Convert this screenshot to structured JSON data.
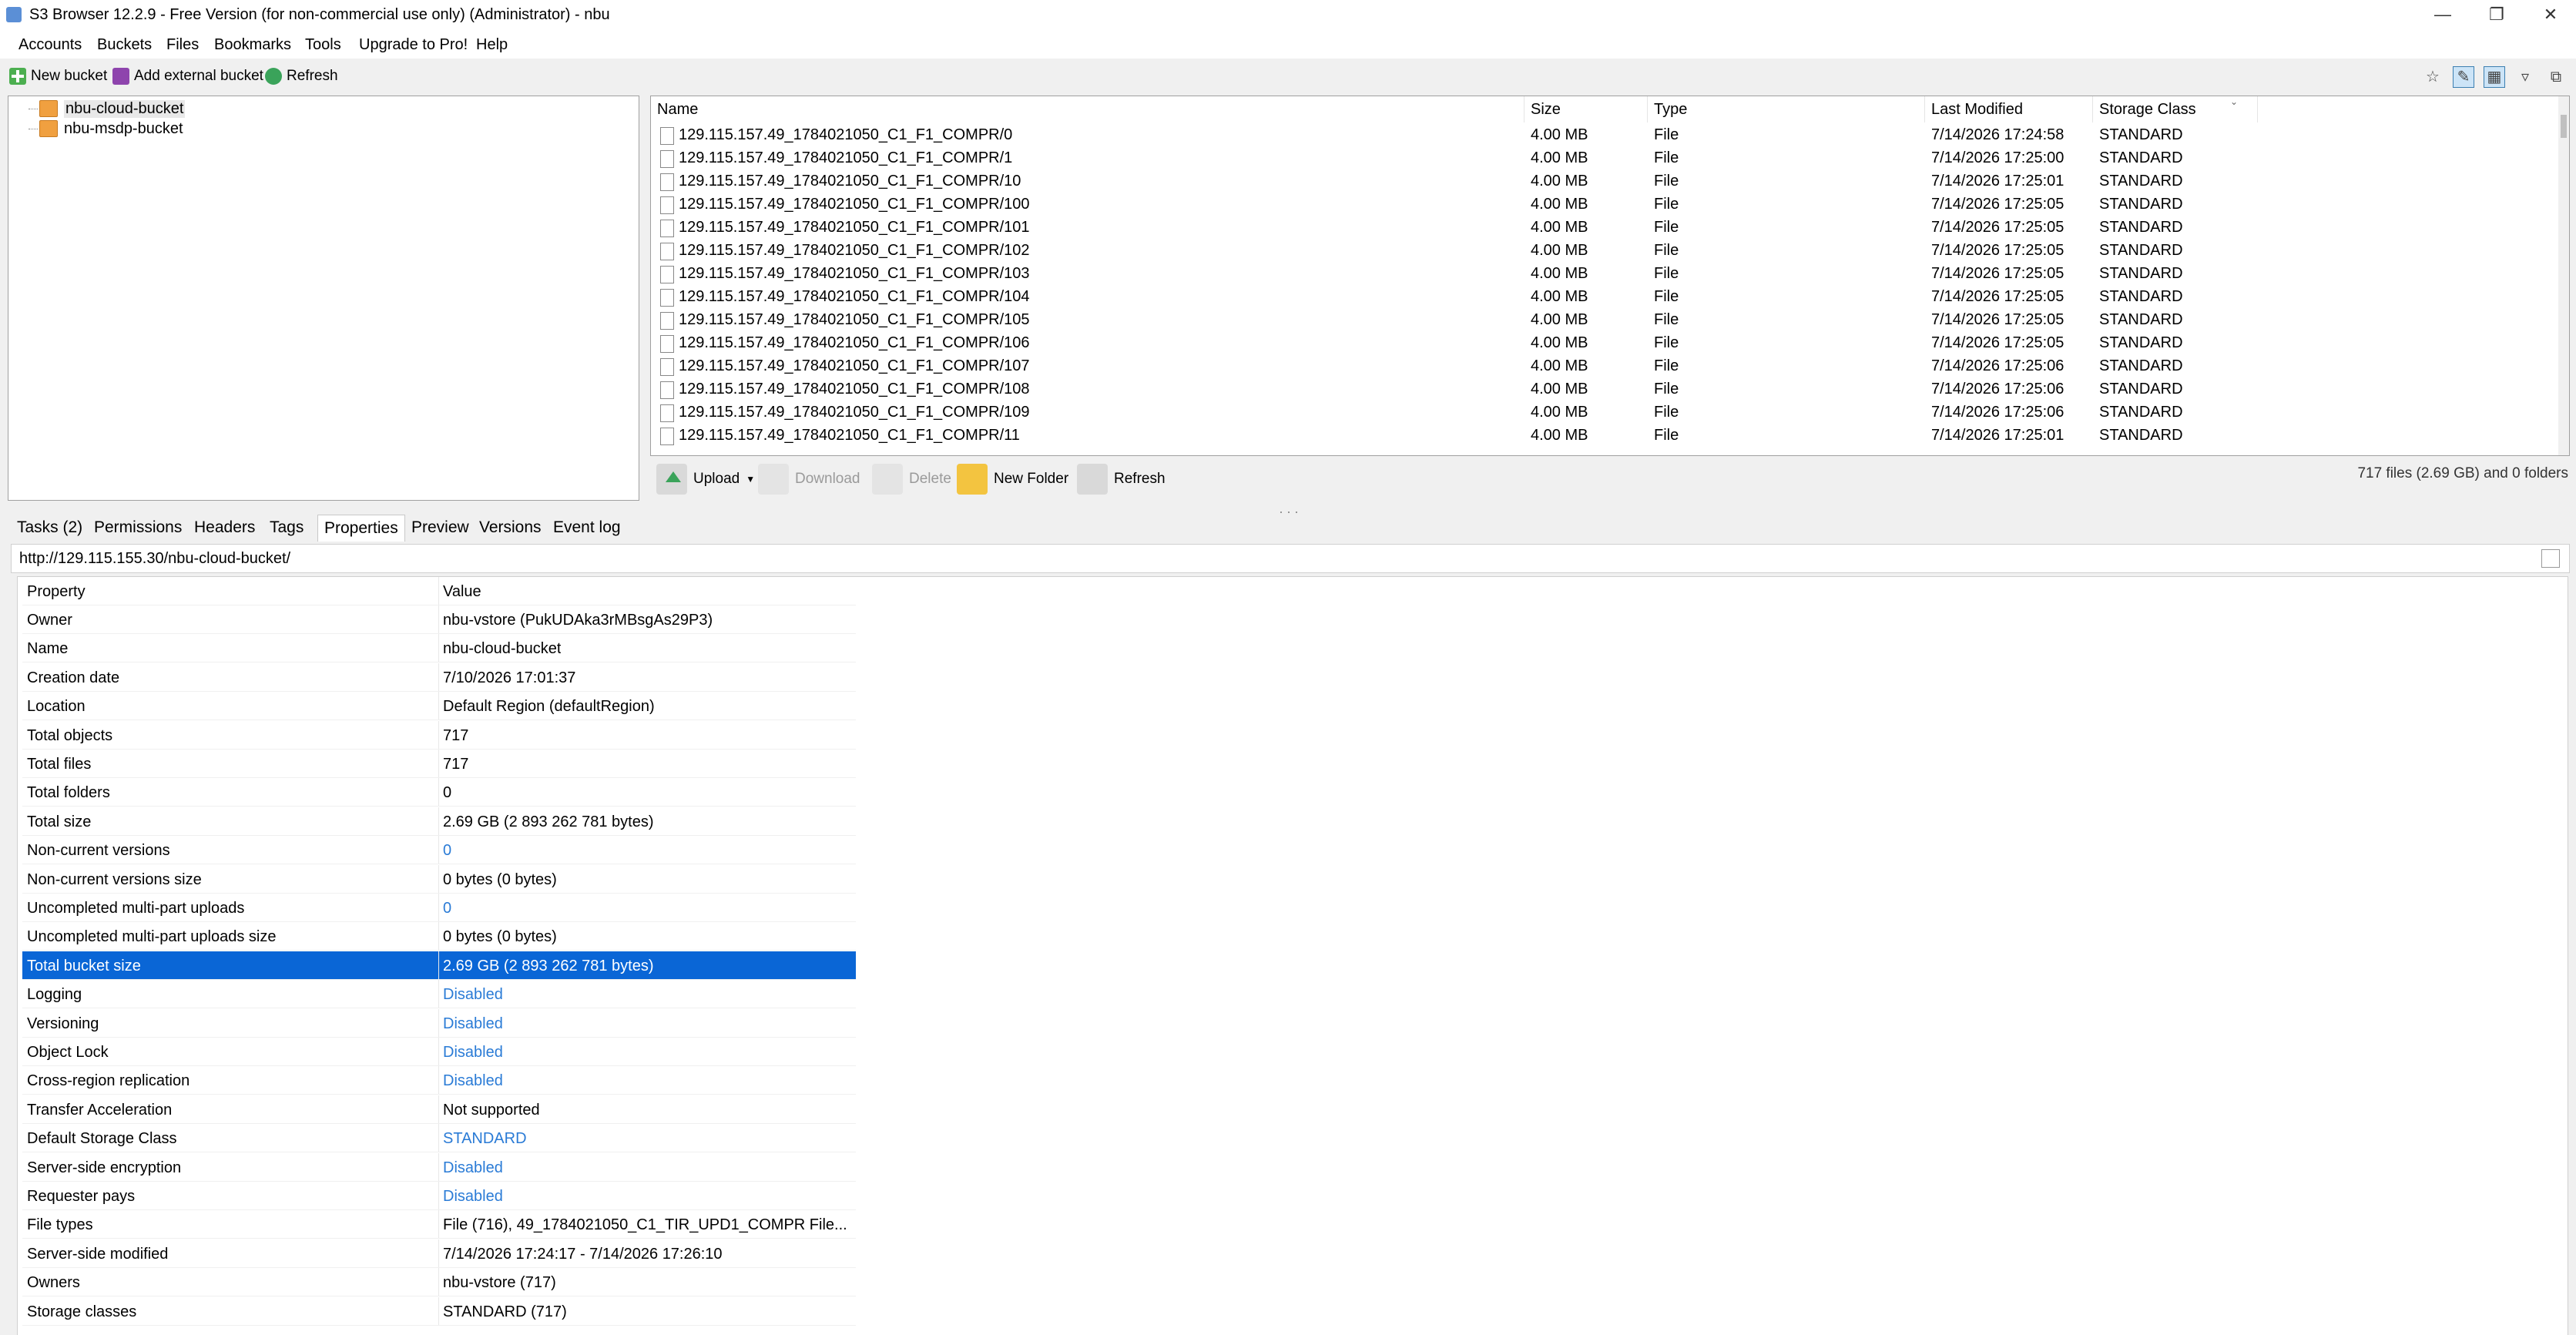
{
  "window": {
    "title": "S3 Browser 12.2.9 - Free Version (for non-commercial use only) (Administrator) - nbu",
    "controls": [
      "minimize",
      "restore",
      "close"
    ]
  },
  "menu": [
    "Accounts",
    "Buckets",
    "Files",
    "Bookmarks",
    "Tools",
    "Upgrade to Pro!",
    "Help"
  ],
  "left_toolbar": {
    "new_bucket": "New bucket",
    "add_external_bucket": "Add external bucket",
    "refresh": "Refresh"
  },
  "buckets": [
    "nbu-cloud-bucket",
    "nbu-msdp-bucket"
  ],
  "file_list": {
    "columns": [
      "Name",
      "Size",
      "Type",
      "Last Modified",
      "Storage Class"
    ],
    "rows": [
      [
        "129.115.157.49_1784021050_C1_F1_COMPR/0",
        "4.00 MB",
        "File",
        "7/14/2026 17:24:58",
        "STANDARD"
      ],
      [
        "129.115.157.49_1784021050_C1_F1_COMPR/1",
        "4.00 MB",
        "File",
        "7/14/2026 17:25:00",
        "STANDARD"
      ],
      [
        "129.115.157.49_1784021050_C1_F1_COMPR/10",
        "4.00 MB",
        "File",
        "7/14/2026 17:25:01",
        "STANDARD"
      ],
      [
        "129.115.157.49_1784021050_C1_F1_COMPR/100",
        "4.00 MB",
        "File",
        "7/14/2026 17:25:05",
        "STANDARD"
      ],
      [
        "129.115.157.49_1784021050_C1_F1_COMPR/101",
        "4.00 MB",
        "File",
        "7/14/2026 17:25:05",
        "STANDARD"
      ],
      [
        "129.115.157.49_1784021050_C1_F1_COMPR/102",
        "4.00 MB",
        "File",
        "7/14/2026 17:25:05",
        "STANDARD"
      ],
      [
        "129.115.157.49_1784021050_C1_F1_COMPR/103",
        "4.00 MB",
        "File",
        "7/14/2026 17:25:05",
        "STANDARD"
      ],
      [
        "129.115.157.49_1784021050_C1_F1_COMPR/104",
        "4.00 MB",
        "File",
        "7/14/2026 17:25:05",
        "STANDARD"
      ],
      [
        "129.115.157.49_1784021050_C1_F1_COMPR/105",
        "4.00 MB",
        "File",
        "7/14/2026 17:25:05",
        "STANDARD"
      ],
      [
        "129.115.157.49_1784021050_C1_F1_COMPR/106",
        "4.00 MB",
        "File",
        "7/14/2026 17:25:05",
        "STANDARD"
      ],
      [
        "129.115.157.49_1784021050_C1_F1_COMPR/107",
        "4.00 MB",
        "File",
        "7/14/2026 17:25:06",
        "STANDARD"
      ],
      [
        "129.115.157.49_1784021050_C1_F1_COMPR/108",
        "4.00 MB",
        "File",
        "7/14/2026 17:25:06",
        "STANDARD"
      ],
      [
        "129.115.157.49_1784021050_C1_F1_COMPR/109",
        "4.00 MB",
        "File",
        "7/14/2026 17:25:06",
        "STANDARD"
      ],
      [
        "129.115.157.49_1784021050_C1_F1_COMPR/11",
        "4.00 MB",
        "File",
        "7/14/2026 17:25:01",
        "STANDARD"
      ]
    ]
  },
  "file_toolbar": {
    "upload": "Upload",
    "download": "Download",
    "delete": "Delete",
    "new_folder": "New Folder",
    "refresh": "Refresh"
  },
  "status": "717 files (2.69 GB) and 0 folders",
  "tabs": [
    "Tasks (2)",
    "Permissions",
    "Headers",
    "Tags",
    "Properties",
    "Preview",
    "Versions",
    "Event log"
  ],
  "active_tab": "Properties",
  "url": "http://129.115.155.30/nbu-cloud-bucket/",
  "properties": {
    "header": {
      "property": "Property",
      "value": "Value"
    },
    "rows": [
      {
        "k": "Owner",
        "v": "nbu-vstore (PukUDAka3rMBsgAs29P3)",
        "link": false
      },
      {
        "k": "Name",
        "v": "nbu-cloud-bucket",
        "link": false
      },
      {
        "k": "Creation date",
        "v": "7/10/2026 17:01:37",
        "link": false
      },
      {
        "k": "Location",
        "v": "Default Region (defaultRegion)",
        "link": false
      },
      {
        "k": "Total objects",
        "v": "717",
        "link": false
      },
      {
        "k": "Total files",
        "v": "717",
        "link": false
      },
      {
        "k": "Total folders",
        "v": "0",
        "link": false
      },
      {
        "k": "Total size",
        "v": "2.69 GB (2 893 262 781 bytes)",
        "link": false
      },
      {
        "k": "Non-current versions",
        "v": "0",
        "link": true
      },
      {
        "k": "Non-current versions size",
        "v": "0 bytes (0 bytes)",
        "link": false
      },
      {
        "k": "Uncompleted multi-part uploads",
        "v": "0",
        "link": true
      },
      {
        "k": "Uncompleted multi-part uploads size",
        "v": "0 bytes (0 bytes)",
        "link": false
      },
      {
        "k": "Total bucket size",
        "v": "2.69 GB (2 893 262 781 bytes)",
        "link": false,
        "selected": true
      },
      {
        "k": "Logging",
        "v": "Disabled",
        "link": true
      },
      {
        "k": "Versioning",
        "v": "Disabled",
        "link": true
      },
      {
        "k": "Object Lock",
        "v": "Disabled",
        "link": true
      },
      {
        "k": "Cross-region replication",
        "v": "Disabled",
        "link": true
      },
      {
        "k": "Transfer Acceleration",
        "v": "Not supported",
        "link": false
      },
      {
        "k": "Default Storage Class",
        "v": "STANDARD",
        "link": true
      },
      {
        "k": "Server-side encryption",
        "v": "Disabled",
        "link": true
      },
      {
        "k": "Requester pays",
        "v": "Disabled",
        "link": true
      },
      {
        "k": "File types",
        "v": "File (716), 49_1784021050_C1_TIR_UPD1_COMPR File...",
        "link": false
      },
      {
        "k": "Server-side modified",
        "v": "7/14/2026 17:24:17 - 7/14/2026 17:26:10",
        "link": false
      },
      {
        "k": "Owners",
        "v": "nbu-vstore (717)",
        "link": false
      },
      {
        "k": "Storage classes",
        "v": "STANDARD (717)",
        "link": false
      }
    ]
  },
  "colors": {
    "selection": "#0a66d6",
    "link": "#2a7bd6",
    "bucket_icon": "#f0a040"
  }
}
